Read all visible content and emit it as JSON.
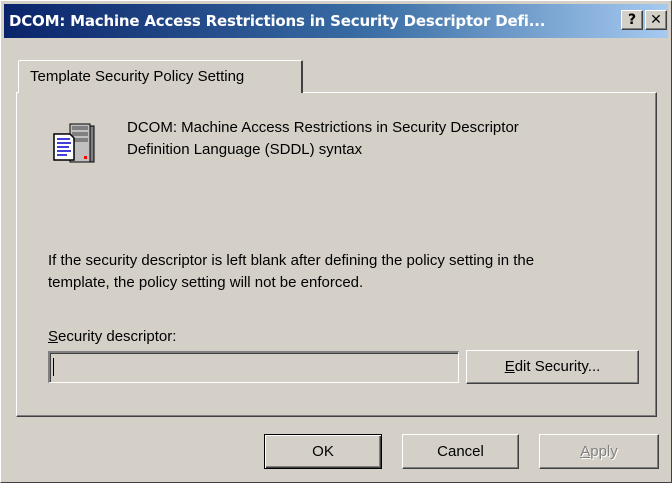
{
  "window": {
    "title": "DCOM: Machine Access Restrictions in Security Descriptor Defi...",
    "help_button": "?",
    "close_button": "✕"
  },
  "tab": {
    "label": "Template Security Policy Setting"
  },
  "policy": {
    "icon": "policy-server-document-icon",
    "name_line1": "DCOM: Machine Access Restrictions in Security Descriptor",
    "name_line2": "Definition Language (SDDL) syntax"
  },
  "info": {
    "line1": "If the security descriptor is left blank after defining the policy setting in the",
    "line2": "template, the policy setting will not be enforced."
  },
  "security_descriptor": {
    "label_mnemonic": "S",
    "label_rest": "ecurity descriptor:",
    "value": ""
  },
  "edit_security_button": {
    "mnemonic": "E",
    "rest": "dit Security..."
  },
  "footer": {
    "ok_label": "OK",
    "cancel_label": "Cancel",
    "apply_mnemonic": "A",
    "apply_rest": "pply"
  },
  "colors": {
    "face": "#d4d0c8",
    "title_start": "#0a246a",
    "title_end": "#a6caf0"
  }
}
